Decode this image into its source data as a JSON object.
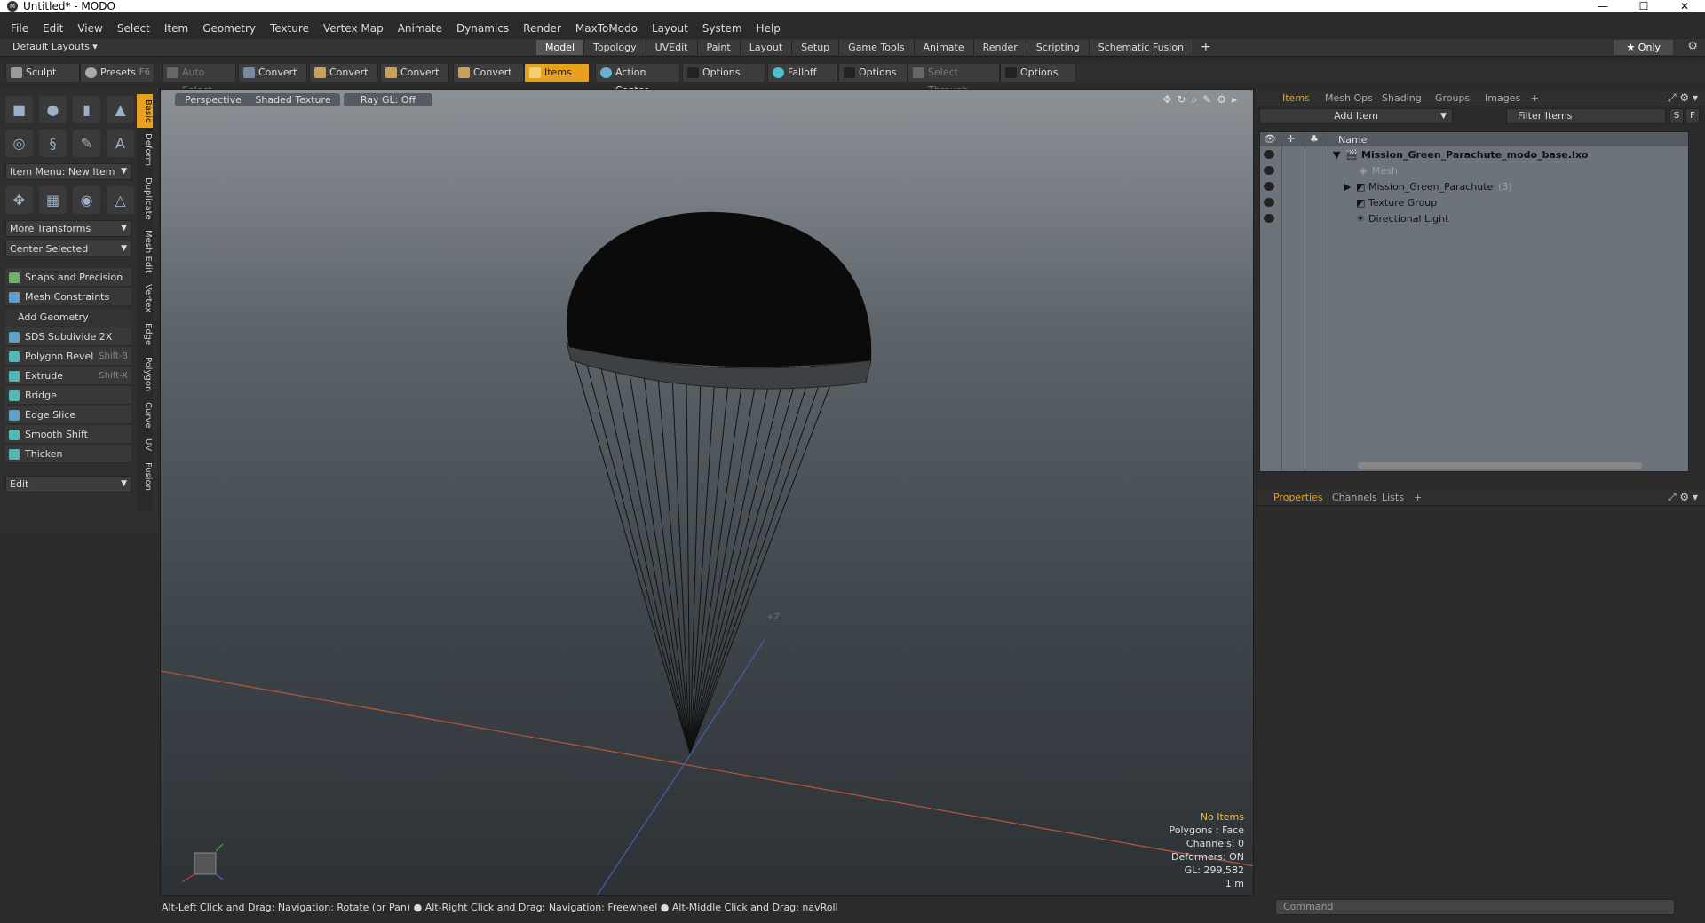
{
  "window": {
    "title": "Untitled* - MODO",
    "minimize": "—",
    "maximize": "☐",
    "close": "✕"
  },
  "menu": [
    "File",
    "Edit",
    "View",
    "Select",
    "Item",
    "Geometry",
    "Texture",
    "Vertex Map",
    "Animate",
    "Dynamics",
    "Render",
    "MaxToModo",
    "Layout",
    "System",
    "Help"
  ],
  "layouts": {
    "label": "Default Layouts ▾",
    "tabs": [
      "Model",
      "Topology",
      "UVEdit",
      "Paint",
      "Layout",
      "Setup",
      "Game Tools",
      "Animate",
      "Render",
      "Scripting",
      "Schematic Fusion"
    ],
    "plus": "+",
    "only": "★ Only"
  },
  "toolbar": {
    "sculpt": "Sculpt",
    "presets": "Presets",
    "presets_key": "F6",
    "auto_select": "Auto Select",
    "convert1": "Convert",
    "convert2": "Convert",
    "convert3": "Convert",
    "convert4": "Convert",
    "items": "Items",
    "action_center": "Action Center",
    "options1": "Options",
    "falloff": "Falloff",
    "options2": "Options",
    "select_through": "Select Through",
    "options3": "Options"
  },
  "left_panel": {
    "vtabs": [
      "Basic",
      "Deform",
      "Duplicate",
      "Mesh Edit",
      "Vertex",
      "Edge",
      "Polygon",
      "Curve",
      "UV",
      "Fusion"
    ],
    "item_menu": "Item Menu: New Item",
    "more_transforms": "More Transforms",
    "center_selected": "Center Selected",
    "snaps": "Snaps and Precision",
    "mesh_constraints": "Mesh Constraints",
    "add_geometry": "Add Geometry",
    "tools": [
      {
        "label": "SDS Subdivide 2X",
        "key": ""
      },
      {
        "label": "Polygon Bevel",
        "key": "Shift-B"
      },
      {
        "label": "Extrude",
        "key": "Shift-X"
      },
      {
        "label": "Bridge",
        "key": ""
      },
      {
        "label": "Edge Slice",
        "key": ""
      },
      {
        "label": "Smooth Shift",
        "key": ""
      },
      {
        "label": "Thicken",
        "key": ""
      }
    ],
    "edit": "Edit"
  },
  "viewport": {
    "perspective": "Perspective",
    "shaded": "Shaded Texture",
    "raygl": "Ray GL: Off",
    "axis_label": "+Z",
    "info": {
      "no_items": "No Items",
      "polygons": "Polygons : Face",
      "channels": "Channels: 0",
      "deformers": "Deformers: ON",
      "gl": "GL: 299,582",
      "scale": "1 m"
    }
  },
  "status": "Alt-Left Click and Drag: Navigation: Rotate (or Pan) ● Alt-Right Click and Drag: Navigation: Freewheel ● Alt-Middle Click and Drag: navRoll",
  "items_panel": {
    "tabs": [
      "Items",
      "Mesh Ops",
      "Shading",
      "Groups",
      "Images"
    ],
    "add_item": "Add Item",
    "filter": "Filter Items",
    "s": "S",
    "f": "F",
    "name_header": "Name",
    "rows": [
      {
        "label": "Mission_Green_Parachute_modo_base.lxo"
      },
      {
        "label": "Mesh"
      },
      {
        "label": "Mission_Green_Parachute",
        "count": "(3)"
      },
      {
        "label": "Texture Group"
      },
      {
        "label": "Directional Light"
      }
    ]
  },
  "props_panel": {
    "tabs": [
      "Properties",
      "Channels",
      "Lists"
    ]
  },
  "command": {
    "placeholder": "Command"
  }
}
